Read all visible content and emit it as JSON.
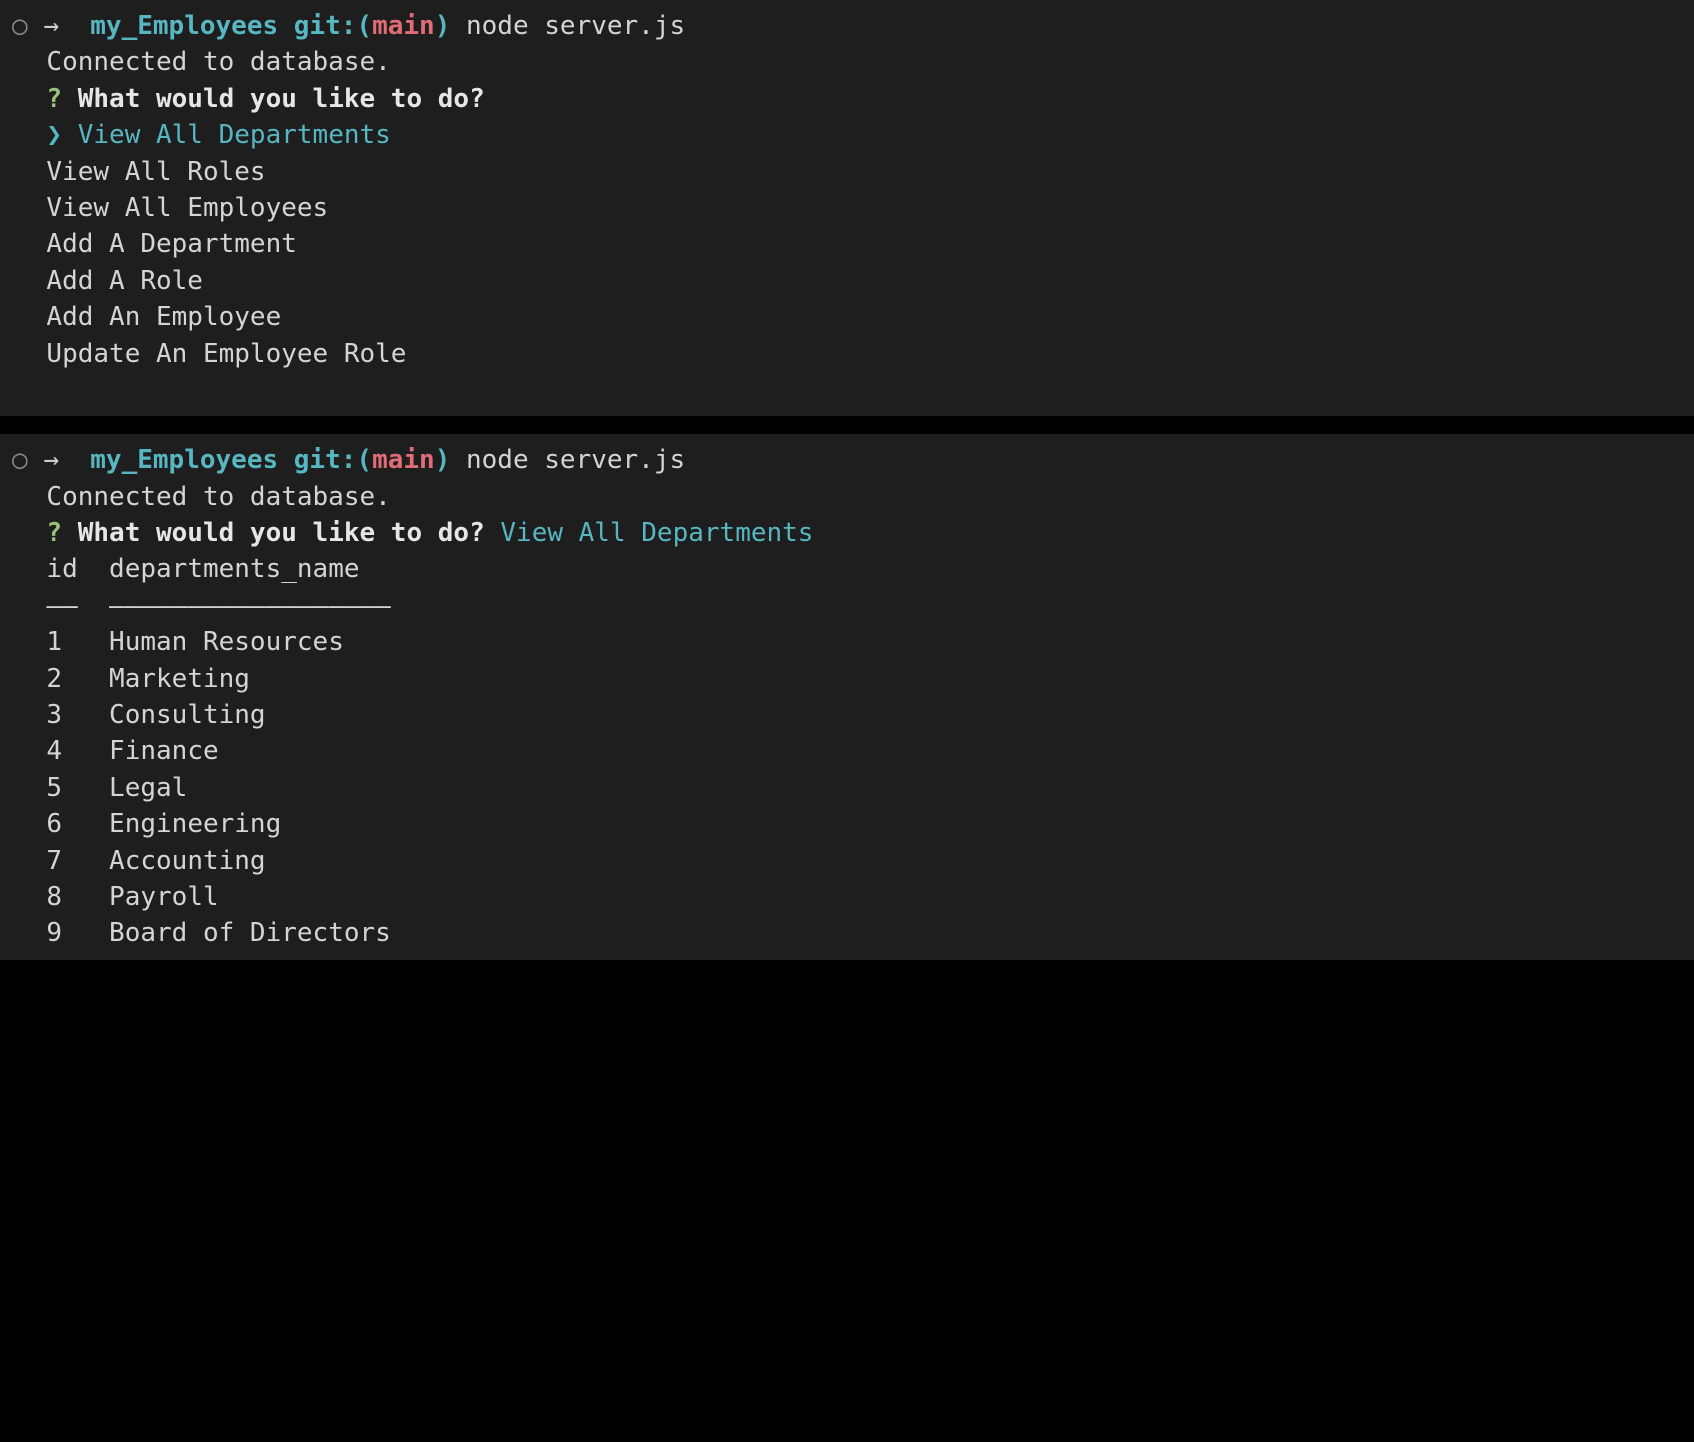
{
  "colors": {
    "teal": "#56b6c2",
    "red": "#e06c75",
    "green": "#98c379",
    "fg": "#d4d4d4",
    "bg1": "#1e1e1e",
    "bg2": "#191919"
  },
  "panel1": {
    "prompt": {
      "circle": "○",
      "arrow": "→",
      "folder": "my_Employees",
      "gitLabel": "git:",
      "openParen": "(",
      "branch": "main",
      "closeParen": ")",
      "command": "node server.js"
    },
    "connectedLine": "Connected to database.",
    "questionMark": "?",
    "questionText": "What would you like to do?",
    "selectedCaret": "❯",
    "selectedOption": "View All Departments",
    "options": [
      "View All Roles",
      "View All Employees",
      "Add A Department",
      "Add A Role",
      "Add An Employee",
      "Update An Employee Role"
    ]
  },
  "panel2": {
    "prompt": {
      "circle": "○",
      "arrow": "→",
      "folder": "my_Employees",
      "gitLabel": "git:",
      "openParen": "(",
      "branch": "main",
      "closeParen": ")",
      "command": "node server.js"
    },
    "connectedLine": "Connected to database.",
    "questionMark": "?",
    "questionText": "What would you like to do?",
    "answer": "View All Departments",
    "table": {
      "headers": {
        "col1": "id",
        "col2": "departments_name"
      },
      "divider": {
        "col1": "——",
        "col2": "——————————————————"
      },
      "rows": [
        {
          "id": "1",
          "name": "Human Resources"
        },
        {
          "id": "2",
          "name": "Marketing"
        },
        {
          "id": "3",
          "name": "Consulting"
        },
        {
          "id": "4",
          "name": "Finance"
        },
        {
          "id": "5",
          "name": "Legal"
        },
        {
          "id": "6",
          "name": "Engineering"
        },
        {
          "id": "7",
          "name": "Accounting"
        },
        {
          "id": "8",
          "name": "Payroll"
        },
        {
          "id": "9",
          "name": "Board of Directors"
        }
      ]
    }
  }
}
